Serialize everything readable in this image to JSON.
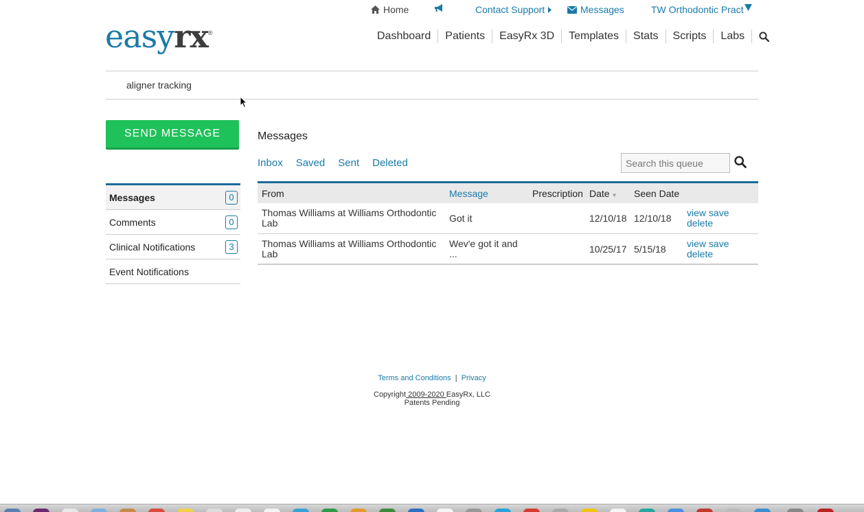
{
  "topbar": {
    "home": "Home",
    "contact_support": "Contact Support",
    "messages": "Messages",
    "account": "TW Orthodontic Pract"
  },
  "logo": {
    "part1": "easy",
    "part2": "rx",
    "reg": "®"
  },
  "mainnav": [
    "Dashboard",
    "Patients",
    "EasyRx 3D",
    "Templates",
    "Stats",
    "Scripts",
    "Labs"
  ],
  "search_strip": {
    "value": "aligner tracking"
  },
  "send_button": "SEND MESSAGE",
  "sidebar": [
    {
      "label": "Messages",
      "count": "0",
      "active": true
    },
    {
      "label": "Comments",
      "count": "0",
      "active": false
    },
    {
      "label": "Clinical Notifications",
      "count": "3",
      "active": false
    },
    {
      "label": "Event Notifications",
      "count": null,
      "active": false
    }
  ],
  "panel": {
    "title": "Messages",
    "tabs": [
      "Inbox",
      "Saved",
      "Sent",
      "Deleted"
    ],
    "search_placeholder": "Search this queue"
  },
  "table": {
    "headers": {
      "from": "From",
      "message": "Message",
      "prescription": "Prescription",
      "date": "Date",
      "seen": "Seen Date"
    },
    "rows": [
      {
        "from": "Thomas Williams at Williams Orthodontic Lab",
        "message": "Got it",
        "prescription": "",
        "date": "12/10/18",
        "seen": "12/10/18",
        "view": "view",
        "save": "save",
        "delete": "delete"
      },
      {
        "from": "Thomas Williams at Williams Orthodontic Lab",
        "message": "Wev'e got it and ...",
        "prescription": "",
        "date": "10/25/17",
        "seen": "5/15/18",
        "view": "view",
        "save": "save",
        "delete": "delete"
      }
    ]
  },
  "footer": {
    "terms": "Terms and Conditions",
    "sep": "|",
    "privacy": "Privacy",
    "copyright_prefix": "Copyright",
    "copyright_years": " 2009-2020 ",
    "copyright_suffix": "EasyRx, LLC",
    "patents": "Patents Pending"
  },
  "colors": {
    "link": "#1a7aa8",
    "accent_dark": "#1a6a96",
    "send_green": "#1fc15a"
  }
}
